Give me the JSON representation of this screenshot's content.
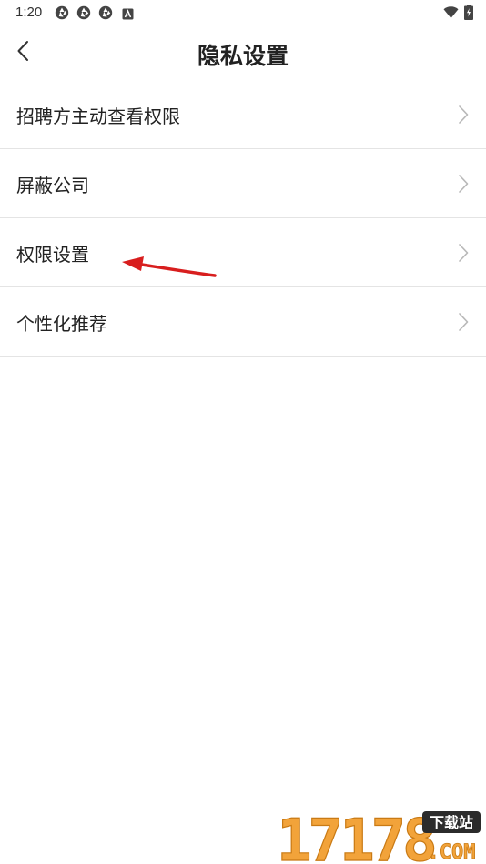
{
  "status_bar": {
    "time": "1:20",
    "notification_icons": [
      "aperture-icon",
      "aperture-icon",
      "aperture-icon",
      "a-badge-icon"
    ],
    "wifi_icon": "wifi-icon",
    "battery_icon": "battery-icon"
  },
  "header": {
    "back_icon": "chevron-left-icon",
    "title": "隐私设置"
  },
  "settings": {
    "items": [
      {
        "label": "招聘方主动查看权限"
      },
      {
        "label": "屏蔽公司"
      },
      {
        "label": "权限设置"
      },
      {
        "label": "个性化推荐"
      }
    ],
    "chevron_icon": "chevron-right-icon"
  },
  "colors": {
    "title_text": "#222222",
    "divider": "#e4e4e4",
    "chevron": "#b8b8b8",
    "annotation_arrow": "#d81e1e",
    "watermark_orange": "#f2a33a",
    "watermark_badge": "#2b2b2b"
  },
  "watermark": {
    "number": "17178",
    "badge": "下载站",
    "domain": ".COM"
  }
}
